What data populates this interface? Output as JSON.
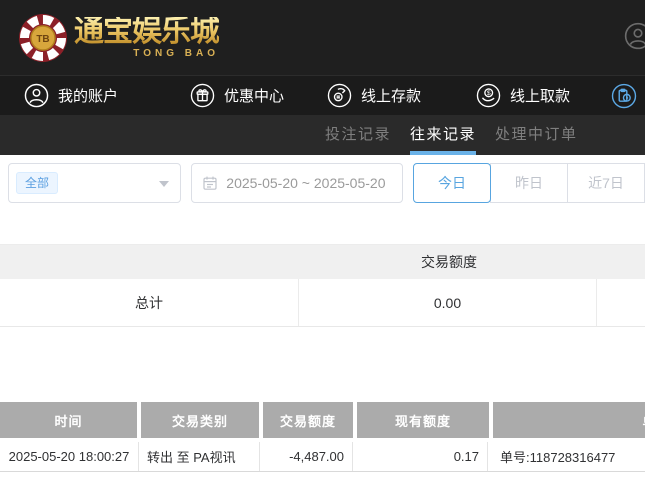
{
  "brand": {
    "title": "通宝娱乐城",
    "subtitle": "TONG BAO",
    "chip_label": "TB"
  },
  "nav": {
    "items": [
      {
        "label": "我的账户",
        "icon": "user-icon"
      },
      {
        "label": "优惠中心",
        "icon": "gift-icon"
      },
      {
        "label": "线上存款",
        "icon": "deposit-icon"
      },
      {
        "label": "线上取款",
        "icon": "withdraw-icon"
      }
    ]
  },
  "tabs": [
    {
      "label": "投注记录",
      "active": false
    },
    {
      "label": "往来记录",
      "active": true
    },
    {
      "label": "处理中订单",
      "active": false
    }
  ],
  "filters": {
    "type_select": {
      "value": "全部"
    },
    "date_range": "2025-05-20 ~ 2025-05-20",
    "quick_buttons": [
      {
        "label": "今日",
        "active": true
      },
      {
        "label": "昨日",
        "active": false
      },
      {
        "label": "近7日",
        "active": false
      }
    ]
  },
  "summary_table": {
    "amount_header": "交易额度",
    "total_label": "总计",
    "total_value": "0.00"
  },
  "records_table": {
    "headers": [
      "时间",
      "交易类别",
      "交易额度",
      "现有额度",
      "单号"
    ],
    "rows": [
      {
        "time": "2025-05-20 18:00:27",
        "type": "转出 至 PA视讯",
        "amount": "-4,487.00",
        "balance": "0.17",
        "order": "单号:118728316477"
      }
    ]
  },
  "colors": {
    "accent_blue": "#58a5e0",
    "tab_underline": "#6ab2e8",
    "gold": "#d9b054",
    "header_dark": "#1f1f1f",
    "table_header_gray": "#ababab"
  }
}
